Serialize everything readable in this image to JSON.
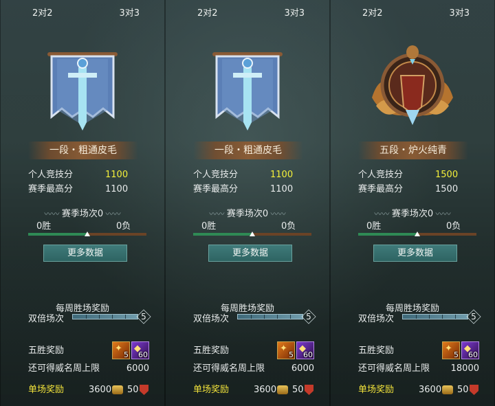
{
  "panels": [
    {
      "tabs": [
        "2对2",
        "3对3"
      ],
      "emblem": "blue-sword-banner-icon",
      "rank": "一段・粗通皮毛",
      "score_label": "个人竞技分",
      "score": "1100",
      "best_label": "赛季最高分",
      "best": "1100",
      "season_title": "赛季场次0",
      "wins": "0胜",
      "losses": "0负",
      "win_ratio": 0.5,
      "more_button": "更多数据",
      "weekly_title": "每周胜场奖励",
      "double_label": "双倍场次",
      "double_count": "5",
      "five_win_label": "五胜奖励",
      "item1_count": "5",
      "item2_count": "60",
      "renown_label": "还可得威名周上限",
      "renown_cap": "6000",
      "single_label": "单场奖励",
      "single_gold": "3600",
      "single_other": "50"
    },
    {
      "tabs": [
        "2对2",
        "3对3"
      ],
      "emblem": "bronze-winged-crest-icon",
      "rank": "五段・炉火纯青",
      "score_label": "个人竞技分",
      "score": "1500",
      "best_label": "赛季最高分",
      "best": "1500",
      "season_title": "赛季场次0",
      "wins": "0胜",
      "losses": "0负",
      "win_ratio": 0.5,
      "more_button": "更多数据",
      "weekly_title": "每周胜场奖励",
      "double_label": "双倍场次",
      "double_count": "5",
      "five_win_label": "五胜奖励",
      "item1_count": "5",
      "item2_count": "60",
      "renown_label": "还可得威名周上限",
      "renown_cap": "18000",
      "single_label": "单场奖励",
      "single_gold": "3600",
      "single_other": "50"
    },
    {
      "tabs": [
        "2对2",
        "3对3"
      ],
      "emblem": "blue-sword-banner-icon",
      "rank": "一段・粗通皮毛",
      "score_label": "个人竞技分",
      "score": "1100",
      "best_label": "赛季最高分",
      "best": "1100",
      "season_title": "赛季场次0",
      "wins": "0胜",
      "losses": "0负",
      "win_ratio": 0.5,
      "more_button": "更多数据",
      "weekly_title": "每周胜场奖励",
      "double_label": "双倍场次",
      "double_count": "5",
      "five_win_label": "五胜奖励",
      "item1_count": "5",
      "item2_count": "60",
      "renown_label": "还可得威名周上限",
      "renown_cap": "6000",
      "single_label": "单场奖励",
      "single_gold": "3600",
      "single_other": "50"
    }
  ],
  "colors": {
    "highlight": "#f4f03a",
    "win": "#2f8a55",
    "loss": "#6a4326",
    "button": "#2e6462"
  }
}
